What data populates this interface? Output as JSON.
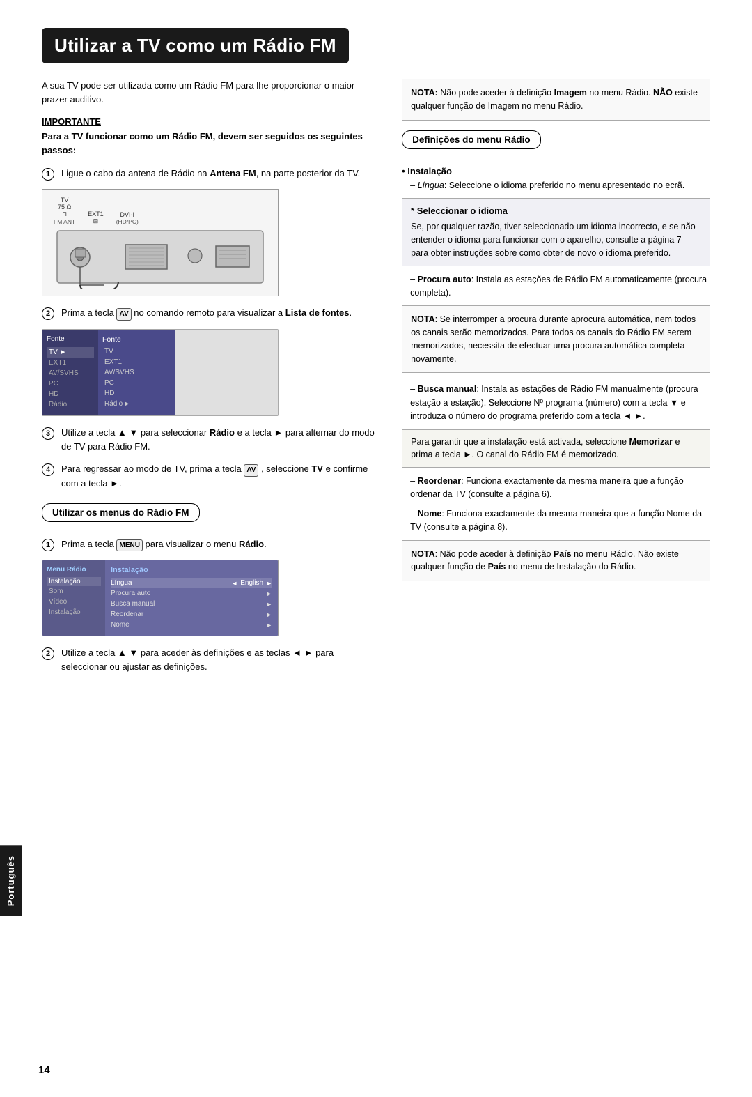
{
  "page": {
    "title": "Utilizar a TV como um Rádio FM",
    "page_number": "14",
    "language_tab": "Português"
  },
  "left_column": {
    "intro": "A sua TV pode ser utilizada como um Rádio FM para lhe proporcionar o maior prazer auditivo.",
    "importante_label": "IMPORTANTE",
    "importante_text": "Para a TV funcionar como um Rádio FM, devem ser seguidos os seguintes passos:",
    "steps": [
      {
        "num": "1",
        "text": "Ligue o cabo da antena de Rádio na Antena FM, na parte posterior da TV."
      },
      {
        "num": "2",
        "text_before": "Prima a tecla",
        "key": "AV",
        "text_after": "no comando remoto para visualizar a Lista de fontes."
      },
      {
        "num": "3",
        "text": "Utilize a tecla ▲ ▼ para seleccionar Rádio e a tecla ► para alternar do modo de TV para Rádio FM."
      },
      {
        "num": "4",
        "text": "Para regressar ao modo de TV, prima a tecla",
        "key": "AV",
        "text_after": ", seleccione TV e confirme com a tecla ►."
      }
    ],
    "tv_diagram": {
      "label": "TV",
      "ports": [
        {
          "top": "75 Ω",
          "bottom": "FM ANT"
        },
        {
          "top": "EXT1",
          "bottom": "⊟"
        },
        {
          "top": "DVI-I",
          "bottom": "(HD/PC)"
        }
      ]
    },
    "menu_fonte": {
      "title": "Fonte",
      "items_col1": [
        "TV ►",
        "EXT1",
        "AV/SVHS",
        "PC",
        "HD",
        "Rádio"
      ],
      "col2_title": "Fonte",
      "items_col2": [
        "TV",
        "EXT1",
        "AV/SVHS",
        "PC",
        "HD",
        "Rádio ►"
      ]
    },
    "utilizar_menus_title": "Utilizar os menus do Rádio FM",
    "step_menus_1": {
      "text_before": "Prima a tecla",
      "key": "MENU",
      "text_after": "para visualizar o menu Rádio."
    },
    "menu_radio": {
      "col1_title": "Menu Rádio",
      "col1_items": [
        "Instalação",
        "Som",
        "Vídeo:",
        "Instalação"
      ],
      "col2_title": "Instalação",
      "col2_items": [
        {
          "label": "Língua",
          "val": "English",
          "arrows": true
        },
        {
          "label": "Procura auto",
          "arrow": true
        },
        {
          "label": "Busca manual",
          "arrow": true
        },
        {
          "label": "Reordenar",
          "arrow": true
        },
        {
          "label": "Nome",
          "arrow": true
        }
      ]
    },
    "step_menus_2": "Utilize a tecla ▲ ▼ para aceder às definições e as teclas ◄ ► para seleccionar ou ajustar as definições."
  },
  "right_column": {
    "nota_box1": {
      "nota_label": "NOTA:",
      "text": "Não pode aceder à definição Imagem no menu Rádio. NÃO existe qualquer função de Imagem no menu Rádio."
    },
    "definicoes_title": "Definições do menu Rádio",
    "instalacao_label": "• Instalação",
    "lingua_dash": "Língua: Seleccione o idioma preferido no menu apresentado no ecrã.",
    "seleccionar_box": {
      "title": "* Seleccionar o idioma",
      "text": "Se, por qualquer razão, tiver seleccionado um idioma incorrecto, e se não entender o idioma para funcionar com o aparelho, consulte a página 7 para obter instruções sobre como obter de novo o idioma preferido."
    },
    "procura_auto_dash": "Procura auto: Instala as estações de Rádio FM automaticamente (procura completa).",
    "nota_box2": {
      "nota_label": "NOTA",
      "text": ": Se interromper a procura durante aprocura automática, nem todos os canais serão memorizados. Para todos os canais do Rádio FM serem memorizados, necessita de efectuar uma procura automática completa novamente."
    },
    "busca_manual_dash": "Busca manual: Instala as estações de Rádio FM manualmente (procura estação a estação). Seleccione Nº programa (número) com a tecla ▼ e introduza o número do programa preferido com a tecla ◄ ►.",
    "garantir_box": {
      "text1": "Para garantir que a instalação está activada, seleccione",
      "bold1": "Memorizar",
      "text2": "e prima a tecla ►. O canal do Rádio FM é memorizado."
    },
    "reordenar_dash": "Reordenar: Funciona exactamente da mesma maneira que a função ordenar da TV (consulte a página 6).",
    "nome_dash": "Nome: Funciona exactamente da mesma maneira que a função Nome da TV (consulte a página 8).",
    "nota_box3": {
      "nota_label": "NOTA",
      "text1": ": Não pode aceder à definição",
      "bold1": "País",
      "text2": "no menu Rádio. Não existe qualquer função de",
      "bold2": "País",
      "text3": "no menu de Instalação do Rádio."
    }
  }
}
